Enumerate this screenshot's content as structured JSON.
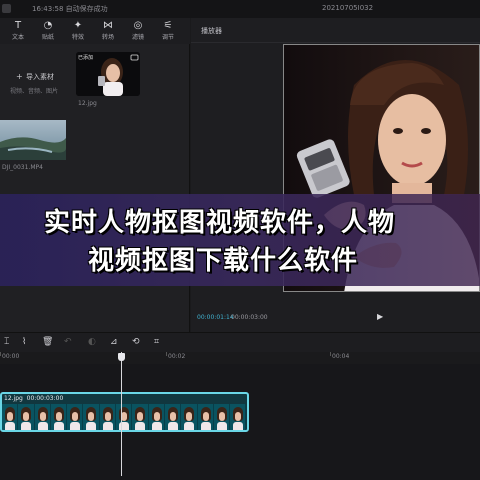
{
  "topbar": {
    "status": "16:43:58 自动保存成功",
    "title": "20210705I032"
  },
  "toolbar": [
    {
      "icon": "text-icon",
      "glyph": "T",
      "label": "文本"
    },
    {
      "icon": "sticker-icon",
      "glyph": "◔",
      "label": "贴纸"
    },
    {
      "icon": "effects-icon",
      "glyph": "✦",
      "label": "特效"
    },
    {
      "icon": "transition-icon",
      "glyph": "⋈",
      "label": "转场"
    },
    {
      "icon": "filter-icon",
      "glyph": "◎",
      "label": "滤镜"
    },
    {
      "icon": "adjust-icon",
      "glyph": "⚟",
      "label": "调节"
    }
  ],
  "media": {
    "import_label": "导入素材",
    "import_hint": "视频、音频、图片",
    "photo_tag": "已添加",
    "photo_name": "12.jpg",
    "video_name": "DJI_0031.MP4"
  },
  "player": {
    "title": "播放器",
    "time_current": "00:00:01:14",
    "time_total": "00:00:03:00"
  },
  "banner": {
    "line1": "实时人物抠图视频软件，人物",
    "line2": "视频抠图下载什么软件"
  },
  "timeline": {
    "ruler": [
      "00:00",
      "00:02",
      "00:04"
    ],
    "clip_name": "12.jpg",
    "clip_duration": "00:00:03:00"
  },
  "colors": {
    "accent": "#41b2d0",
    "clip_border": "#6ad6e6",
    "banner": "#2a2258"
  }
}
